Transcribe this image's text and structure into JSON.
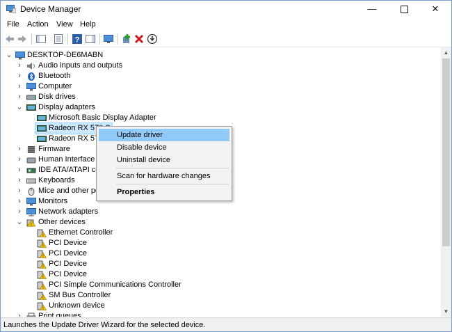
{
  "window": {
    "title": "Device Manager",
    "minimize_icon": "minimize-icon",
    "maximize_icon": "maximize-icon",
    "close_icon": "close-icon"
  },
  "menu": [
    "File",
    "Action",
    "View",
    "Help"
  ],
  "toolbar": [
    "back-icon",
    "forward-icon",
    "show-hide-console-tree-icon",
    "properties-icon",
    "help-icon",
    "show-action-pane-icon",
    "monitor-icon",
    "add-driver-icon",
    "uninstall-icon",
    "update-driver-icon"
  ],
  "tree": {
    "root": "DESKTOP-DE6MABN",
    "items": [
      {
        "label": "Audio inputs and outputs",
        "icon": "speaker-icon"
      },
      {
        "label": "Bluetooth",
        "icon": "bluetooth-icon"
      },
      {
        "label": "Computer",
        "icon": "computer-icon"
      },
      {
        "label": "Disk drives",
        "icon": "disk-icon"
      },
      {
        "label": "Display adapters",
        "icon": "display-adapter-icon"
      },
      {
        "label": "Microsoft Basic Display Adapter",
        "icon": "display-adapter-icon"
      },
      {
        "label": "Radeon RX 570 S",
        "icon": "display-adapter-icon"
      },
      {
        "label": "Radeon RX 570",
        "icon": "display-adapter-icon"
      },
      {
        "label": "Firmware",
        "icon": "firmware-icon"
      },
      {
        "label": "Human Interface D",
        "icon": "hid-icon"
      },
      {
        "label": "IDE ATA/ATAPI con",
        "icon": "ide-icon"
      },
      {
        "label": "Keyboards",
        "icon": "keyboard-icon"
      },
      {
        "label": "Mice and other poi",
        "icon": "mouse-icon"
      },
      {
        "label": "Monitors",
        "icon": "monitor-icon"
      },
      {
        "label": "Network adapters",
        "icon": "network-icon"
      },
      {
        "label": "Other devices",
        "icon": "other-devices-icon"
      },
      {
        "label": "Ethernet Controller",
        "icon": "unknown-device-icon"
      },
      {
        "label": "PCI Device",
        "icon": "unknown-device-icon"
      },
      {
        "label": "PCI Device",
        "icon": "unknown-device-icon"
      },
      {
        "label": "PCI Device",
        "icon": "unknown-device-icon"
      },
      {
        "label": "PCI Device",
        "icon": "unknown-device-icon"
      },
      {
        "label": "PCI Simple Communications Controller",
        "icon": "unknown-device-icon"
      },
      {
        "label": "SM Bus Controller",
        "icon": "unknown-device-icon"
      },
      {
        "label": "Unknown device",
        "icon": "unknown-device-icon"
      },
      {
        "label": "Print queues",
        "icon": "printer-icon"
      }
    ]
  },
  "context_menu": {
    "items": [
      "Update driver",
      "Disable device",
      "Uninstall device",
      "Scan for hardware changes",
      "Properties"
    ],
    "highlighted": "Update driver"
  },
  "status_bar": "Launches the Update Driver Wizard for the selected device.",
  "colors": {
    "selection": "#cce8ff",
    "menu_highlight": "#91c9f7",
    "status_bg": "#f0f0f0"
  }
}
